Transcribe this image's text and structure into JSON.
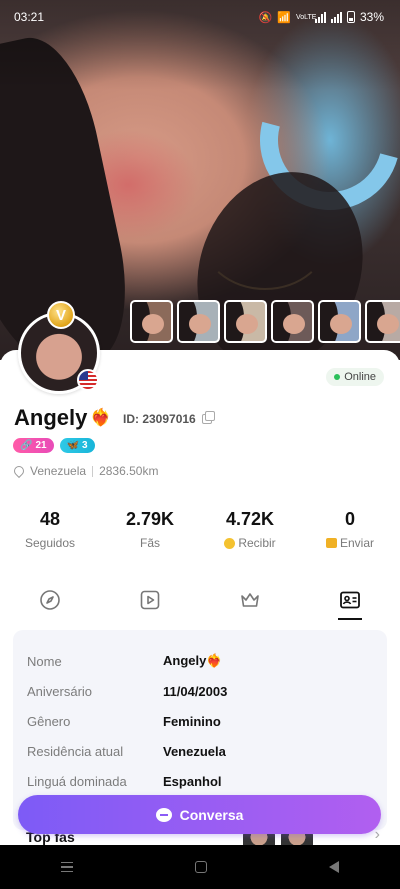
{
  "status_bar": {
    "time": "03:21",
    "battery": "33%",
    "network": "VoLTE"
  },
  "profile": {
    "vip_letter": "V",
    "name": "Angely",
    "name_emoji": "❤️‍🔥",
    "id_label": "ID: 23097016",
    "online_label": "Online",
    "levels": [
      {
        "icon": "🔗",
        "value": "21",
        "color": "#ff5ba8"
      },
      {
        "icon": "🦋",
        "value": "3",
        "color": "#2fc9e6"
      }
    ],
    "location": "Venezuela",
    "distance": "2836.50km"
  },
  "stats": [
    {
      "value": "48",
      "label": "Seguidos"
    },
    {
      "value": "2.79K",
      "label": "Fãs"
    },
    {
      "value": "4.72K",
      "label": "Recibir",
      "icon": "coin-icon"
    },
    {
      "value": "0",
      "label": "Enviar",
      "icon": "gift-icon"
    }
  ],
  "tabs": [
    {
      "name": "compass-icon",
      "active": false
    },
    {
      "name": "video-icon",
      "active": false
    },
    {
      "name": "crown-icon",
      "active": false
    },
    {
      "name": "profile-card-icon",
      "active": true
    }
  ],
  "info": [
    {
      "key": "Nome",
      "value": "Angely❤️‍🔥"
    },
    {
      "key": "Aniversário",
      "value": "11/04/2003"
    },
    {
      "key": "Gênero",
      "value": "Feminino"
    },
    {
      "key": "Residência atual",
      "value": "Venezuela"
    },
    {
      "key": "Linguá dominada",
      "value": "Espanhol"
    }
  ],
  "fans_section": {
    "title": "Top fãs"
  },
  "cta": {
    "label": "Conversa"
  },
  "colors": {
    "accent_start": "#7d5bf6",
    "accent_end": "#b15ff0",
    "online": "#2bc05a"
  }
}
